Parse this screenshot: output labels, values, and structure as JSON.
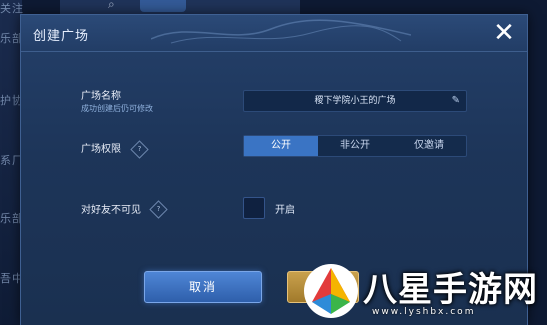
{
  "background": {
    "top_label": "关注",
    "side_items": [
      "乐部",
      "护协",
      "系厂",
      "乐部",
      "吾中"
    ]
  },
  "dialog": {
    "title": "创建广场",
    "close_icon": "close-icon"
  },
  "form": {
    "name_label": "广场名称",
    "name_hint": "成功创建后仍可修改",
    "name_value": "稷下学院小王的广场",
    "permission_label": "广场权限",
    "permission_options": [
      "公开",
      "非公开",
      "仅邀请"
    ],
    "permission_selected": "公开",
    "hide_friends_label": "对好友不可见",
    "hide_friends_toggle_label": "开启"
  },
  "buttons": {
    "cancel": "取消"
  },
  "watermark": {
    "brand": "八星手游网",
    "url": "www.lyshbx.com"
  },
  "colors": {
    "accent": "#3a74c4",
    "panel": "#1d3559"
  }
}
